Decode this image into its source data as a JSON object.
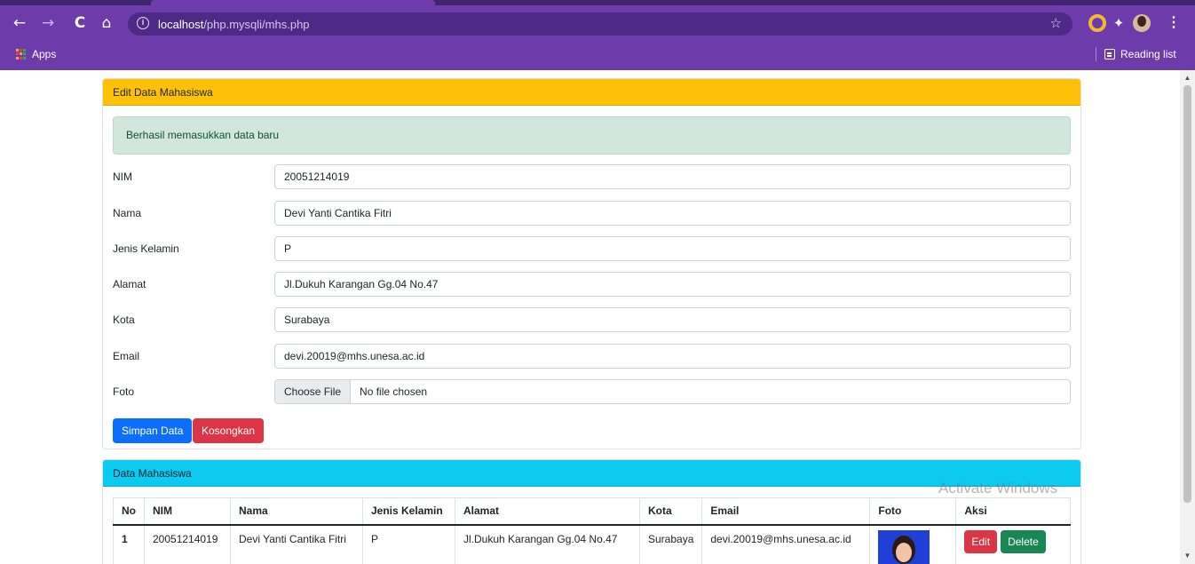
{
  "browser": {
    "url_host": "localhost",
    "url_path": "/php.mysqli/mhs.php",
    "bookmarks": {
      "apps_label": "Apps",
      "reading_list_label": "Reading list"
    }
  },
  "edit_card": {
    "header": "Edit Data Mahasiswa",
    "alert": "Berhasil memasukkan data baru",
    "fields": {
      "nim": {
        "label": "NIM",
        "value": "20051214019"
      },
      "nama": {
        "label": "Nama",
        "value": "Devi Yanti Cantika Fitri"
      },
      "jenis_kelamin": {
        "label": "Jenis Kelamin",
        "value": "P"
      },
      "alamat": {
        "label": "Alamat",
        "value": "Jl.Dukuh Karangan Gg.04 No.47"
      },
      "kota": {
        "label": "Kota",
        "value": "Surabaya"
      },
      "email": {
        "label": "Email",
        "value": "devi.20019@mhs.unesa.ac.id"
      },
      "foto": {
        "label": "Foto",
        "button": "Choose File",
        "status": "No file chosen"
      }
    },
    "buttons": {
      "save": "Simpan Data",
      "clear": "Kosongkan"
    }
  },
  "data_card": {
    "header": "Data Mahasiswa",
    "columns": [
      "No",
      "NIM",
      "Nama",
      "Jenis Kelamin",
      "Alamat",
      "Kota",
      "Email",
      "Foto",
      "Aksi"
    ],
    "rows": [
      {
        "no": "1",
        "nim": "20051214019",
        "nama": "Devi Yanti Cantika Fitri",
        "jenis_kelamin": "P",
        "alamat": "Jl.Dukuh Karangan Gg.04 No.47",
        "kota": "Surabaya",
        "email": "devi.20019@mhs.unesa.ac.id",
        "edit_label": "Edit",
        "delete_label": "Delete"
      }
    ]
  },
  "watermark": "Activate Windows",
  "colors": {
    "browser_frame": "#6c3cab",
    "edit_header": "#ffc107",
    "data_header": "#0dcaf0",
    "alert_bg": "#d1e7dd",
    "primary": "#0d6efd",
    "danger": "#dc3545",
    "success": "#198754"
  }
}
